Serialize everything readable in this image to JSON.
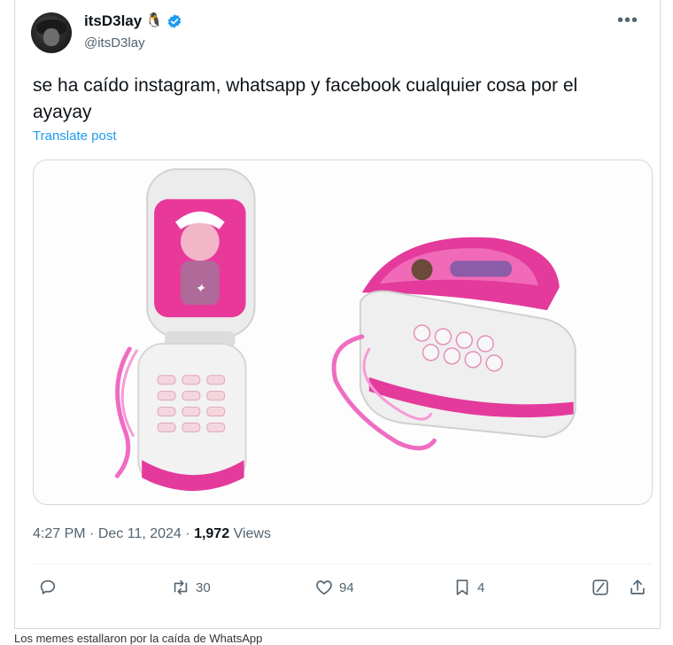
{
  "author": {
    "display_name": "itsD3lay",
    "emoji": "🐧",
    "handle": "@itsD3lay"
  },
  "tweet": {
    "text": "se ha caído instagram,  whatsapp y facebook cualquier cosa por el ayayay",
    "translate_label": "Translate post"
  },
  "meta": {
    "time": "4:27 PM",
    "separator": "·",
    "date": "Dec 11, 2024",
    "views_count": "1,972",
    "views_label": "Views"
  },
  "actions": {
    "reply_count": "",
    "retweet_count": "30",
    "like_count": "94",
    "bookmark_count": "4"
  },
  "icons": [
    "more-icon",
    "verified-icon",
    "reply-icon",
    "retweet-icon",
    "like-icon",
    "bookmark-icon",
    "grok-icon",
    "share-icon"
  ],
  "colors": {
    "accent": "#1d9bf0",
    "muted": "#536471",
    "text": "#0f1419",
    "toy_pink": "#e43a9c"
  },
  "caption": "Los memes estallaron por la caída de WhatsApp"
}
